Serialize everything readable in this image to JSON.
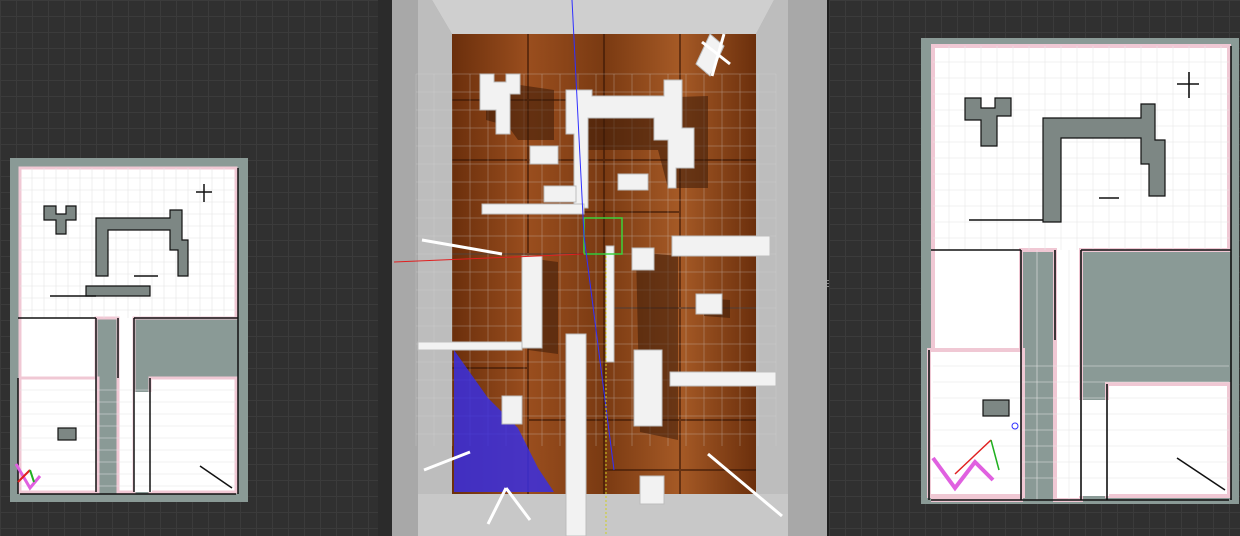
{
  "window": {
    "panels": [
      {
        "id": "left",
        "view": "occupancy-map",
        "robot": "pose-arrow",
        "footprint": "magenta"
      },
      {
        "id": "center",
        "view": "3d-simulation",
        "floor_texture": "wood",
        "laser_cone": "blue"
      },
      {
        "id": "right",
        "view": "occupancy-map",
        "robot": "pose-axes",
        "footprint": "magenta"
      }
    ]
  },
  "colors": {
    "background": "#303030",
    "map_unknown": "#8a9a96",
    "map_free": "#ffffff",
    "map_obstacle": "#111111",
    "inflation": "#e8b8c6",
    "wall": "#f2f2f2",
    "wood": "#7a3a12",
    "laser": "#3a2fe0",
    "footprint": "#e060e0",
    "axis_x": "#e02020",
    "axis_y": "#20b020",
    "axis_z": "#3030ff"
  },
  "icons": [
    "robot-pose-icon",
    "coordinate-axes-icon",
    "splitter-grip-icon"
  ]
}
